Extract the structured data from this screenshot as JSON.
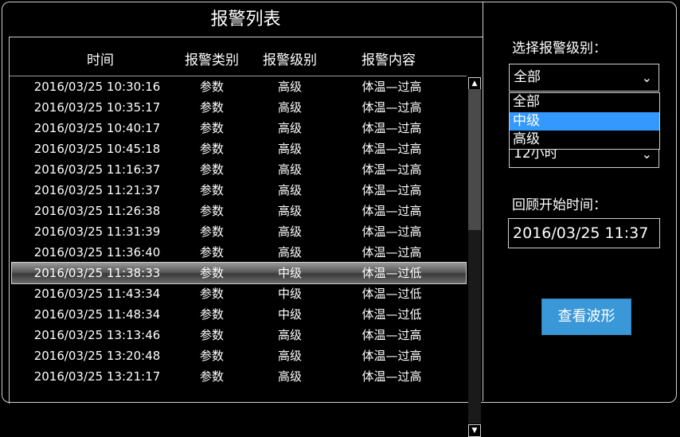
{
  "list": {
    "title": "报警列表",
    "headers": {
      "time": "时间",
      "type": "报警类别",
      "level": "报警级别",
      "content": "报警内容"
    },
    "rows": [
      {
        "time": "2016/03/25 10:30:16",
        "type": "参数",
        "level": "高级",
        "content": "体温—过高"
      },
      {
        "time": "2016/03/25 10:35:17",
        "type": "参数",
        "level": "高级",
        "content": "体温—过高"
      },
      {
        "time": "2016/03/25 10:40:17",
        "type": "参数",
        "level": "高级",
        "content": "体温—过高"
      },
      {
        "time": "2016/03/25 10:45:18",
        "type": "参数",
        "level": "高级",
        "content": "体温—过高"
      },
      {
        "time": "2016/03/25 11:16:37",
        "type": "参数",
        "level": "高级",
        "content": "体温—过高"
      },
      {
        "time": "2016/03/25 11:21:37",
        "type": "参数",
        "level": "高级",
        "content": "体温—过高"
      },
      {
        "time": "2016/03/25 11:26:38",
        "type": "参数",
        "level": "高级",
        "content": "体温—过高"
      },
      {
        "time": "2016/03/25 11:31:39",
        "type": "参数",
        "level": "高级",
        "content": "体温—过高"
      },
      {
        "time": "2016/03/25 11:36:40",
        "type": "参数",
        "level": "高级",
        "content": "体温—过高"
      },
      {
        "time": "2016/03/25 11:38:33",
        "type": "参数",
        "level": "中级",
        "content": "体温—过低"
      },
      {
        "time": "2016/03/25 11:43:34",
        "type": "参数",
        "level": "中级",
        "content": "体温—过低"
      },
      {
        "time": "2016/03/25 11:48:34",
        "type": "参数",
        "level": "中级",
        "content": "体温—过低"
      },
      {
        "time": "2016/03/25 13:13:46",
        "type": "参数",
        "level": "高级",
        "content": "体温—过高"
      },
      {
        "time": "2016/03/25 13:20:48",
        "type": "参数",
        "level": "高级",
        "content": "体温—过高"
      },
      {
        "time": "2016/03/25 13:21:17",
        "type": "参数",
        "level": "高级",
        "content": "体温—过高"
      }
    ],
    "selected_row_index": 9
  },
  "scrollbar": {
    "up_icon": "triangle-up-icon",
    "down_icon": "triangle-down-icon"
  },
  "side": {
    "level_label": "选择报警级别：",
    "level_value": "全部",
    "level_options": [
      "全部",
      "中级",
      "高级"
    ],
    "highlighted_option": "中级",
    "period_value_partial": "12小时",
    "review_label": "回顾开始时间：",
    "review_value": "2016/03/25 11:37",
    "view_button": "查看波形"
  },
  "colors": {
    "accent": "#3399ff",
    "button": "#3a98d8",
    "background": "#000000",
    "border": "#cfcfcf"
  }
}
